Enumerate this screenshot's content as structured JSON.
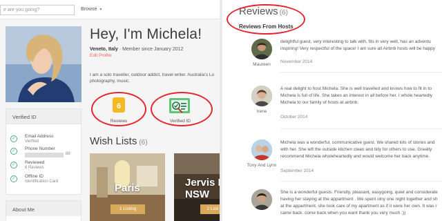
{
  "left": {
    "search": {
      "placeholder": "e are you going?"
    },
    "browse_label": "Browse",
    "profile": {
      "name": "Hey, I'm Michela!",
      "location": "Veneto, Italy",
      "member_since": " · Member since January 2012",
      "edit_link": "Edit Profile",
      "bio_line1": "I am a solo traveller, outdoor addict, travel writer. Australia's Lo",
      "bio_line2": "photography, music."
    },
    "badges": {
      "reviews_count": "6",
      "reviews_label": "Reviews",
      "verified_label": "Verified ID"
    },
    "verified_panel": {
      "title": "Verified ID",
      "items": [
        {
          "label": "Email Address",
          "sub": "Verified"
        },
        {
          "label": "Phone Number",
          "sub": "88"
        },
        {
          "label": "Reviewed",
          "sub": "6 Reviews"
        },
        {
          "label": "Offline ID",
          "sub": "Identification Card"
        }
      ]
    },
    "about_title": "About Me",
    "wish_lists": {
      "title": "Wish Lists",
      "count": "(6)",
      "cards": [
        {
          "title": "Paris",
          "listing": "1 Listing"
        },
        {
          "title": "Jervis B\nNSW",
          "listing": "2 Listi"
        }
      ]
    }
  },
  "right": {
    "title": "Reviews",
    "count": "(6)",
    "subtitle": "Reviews From Hosts",
    "reviews": [
      {
        "author": "Maureen",
        "lines": [
          "delightful guest, very interesting to talk with, fits in very well, has an adventu",
          "inspiring! Very respectful of the space! I am sure all Airbnb hosts will be happy"
        ],
        "date": "November 2014"
      },
      {
        "author": "Irene",
        "lines": [
          "A real delight to host Michela. She is well travelled and knows how to fit in to",
          "Michela is full of life. She takes an interest in all before her. I whole heartedly",
          "Michela to our family of hosts at airbnb."
        ],
        "date": "October 2014"
      },
      {
        "author": "Tony And Lynn",
        "lines": [
          "Michela was a wonderful, communicative guest. We shared lots of stories and",
          "with her. She left the outside kitchen clean and tidy for others to use. Greatly",
          "recommend Michela wholeheartedly and would welcome her back anytime."
        ],
        "date": "September 2014"
      },
      {
        "author": "",
        "lines": [
          "She is a wonderful guests. Friendly, pleasant, easygoing, quiet and considerate",
          "having her staying at the appartment . We spent olny one night together and sh",
          "at the appartment. she took care of my apartment as if it were her own. It was r",
          "came back. come back when you want thank you very much ;))"
        ],
        "date": ""
      }
    ]
  },
  "colors": {
    "accent": "#ff5a5f",
    "annotation_red": "#e3262f",
    "verified_green": "#46b078",
    "reviews_badge": "#f5b820",
    "listing_tag": "#d9a95b"
  }
}
